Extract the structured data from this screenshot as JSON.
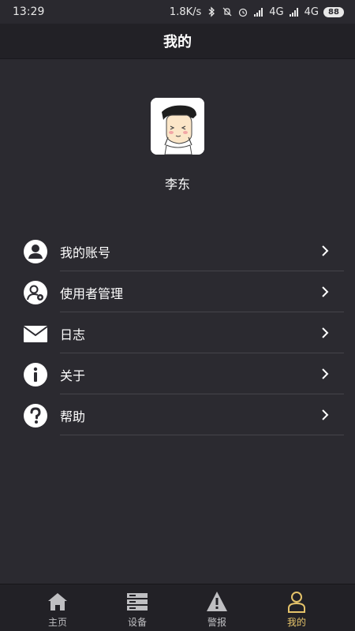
{
  "status_bar": {
    "time": "13:29",
    "speed": "1.8K/s",
    "network1": "4G",
    "network2": "4G",
    "battery": "88"
  },
  "header": {
    "title": "我的"
  },
  "profile": {
    "name": "李东"
  },
  "menu": {
    "items": [
      {
        "label": "我的账号",
        "icon": "person-circle-icon"
      },
      {
        "label": "使用者管理",
        "icon": "user-settings-icon"
      },
      {
        "label": "日志",
        "icon": "mail-icon"
      },
      {
        "label": "关于",
        "icon": "info-icon"
      },
      {
        "label": "帮助",
        "icon": "help-icon"
      }
    ]
  },
  "tabs": [
    {
      "label": "主页",
      "icon": "home-icon",
      "active": false
    },
    {
      "label": "设备",
      "icon": "devices-icon",
      "active": false
    },
    {
      "label": "警报",
      "icon": "warning-icon",
      "active": false
    },
    {
      "label": "我的",
      "icon": "person-outline-icon",
      "active": true
    }
  ],
  "colors": {
    "background": "#2b2a30",
    "bar": "#222126",
    "accent": "#e5c36a",
    "text": "#ffffff"
  }
}
